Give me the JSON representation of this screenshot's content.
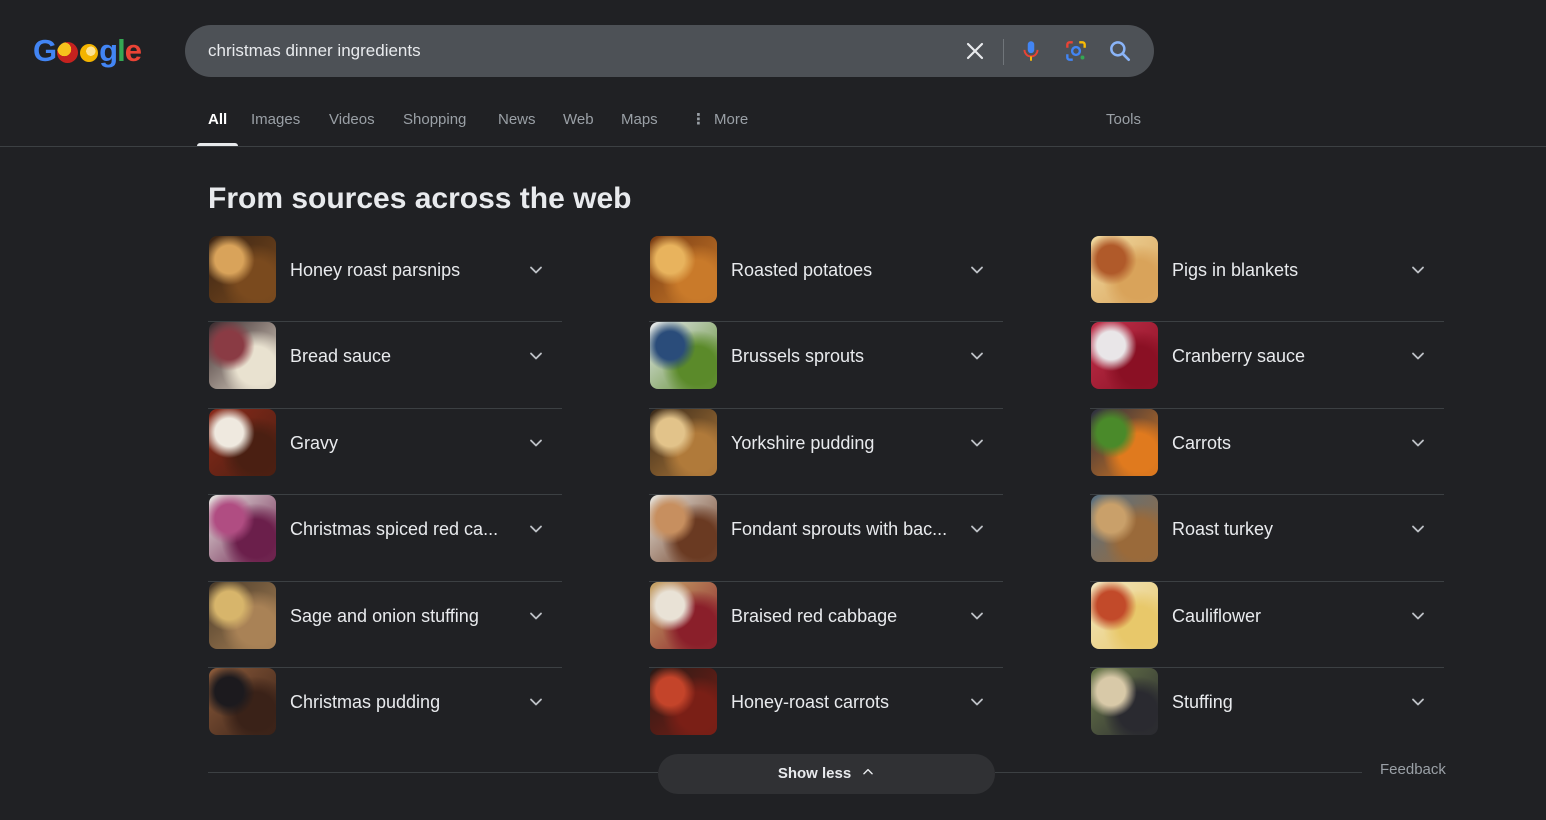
{
  "logo": {
    "label": "Google"
  },
  "search": {
    "value": "christmas dinner ingredients",
    "placeholder": "Search"
  },
  "tabs": [
    {
      "label": "All",
      "active": true
    },
    {
      "label": "Images"
    },
    {
      "label": "Videos"
    },
    {
      "label": "Shopping"
    },
    {
      "label": "News"
    },
    {
      "label": "Web"
    },
    {
      "label": "Maps"
    },
    {
      "label": "More"
    }
  ],
  "tools_label": "Tools",
  "heading": "From sources across the web",
  "columns": [
    [
      {
        "label": "Honey roast parsnips",
        "colors": [
          "#7a4a1e",
          "#d9a35a",
          "#3a2414"
        ]
      },
      {
        "label": "Bread sauce",
        "colors": [
          "#e9e2d0",
          "#8a3b44",
          "#3b2a2e"
        ]
      },
      {
        "label": "Gravy",
        "colors": [
          "#4a1f12",
          "#efe9df",
          "#8a2a1a"
        ]
      },
      {
        "label": "Christmas spiced red ca...",
        "colors": [
          "#6b1f4b",
          "#b04d82",
          "#e7e3e0"
        ]
      },
      {
        "label": "Sage and onion stuffing",
        "colors": [
          "#a98256",
          "#d7b56b",
          "#4a3b2a"
        ]
      },
      {
        "label": "Christmas pudding",
        "colors": [
          "#3a2218",
          "#1c1a1e",
          "#8a5a3a"
        ]
      }
    ],
    [
      {
        "label": "Roasted potatoes",
        "colors": [
          "#c97a2a",
          "#e8b35d",
          "#7a3d14"
        ]
      },
      {
        "label": "Brussels sprouts",
        "colors": [
          "#5b8a2a",
          "#2a4c7a",
          "#e6e9ef"
        ]
      },
      {
        "label": "Yorkshire pudding",
        "colors": [
          "#b07a3a",
          "#e2c38a",
          "#3a2a1a"
        ]
      },
      {
        "label": "Fondant sprouts with bac...",
        "colors": [
          "#6a3a22",
          "#c78f5f",
          "#e8e4dc"
        ]
      },
      {
        "label": "Braised red cabbage",
        "colors": [
          "#8a1f2a",
          "#e9e2d6",
          "#c8a86a"
        ]
      },
      {
        "label": "Honey-roast carrots",
        "colors": [
          "#7a1f16",
          "#c4442a",
          "#2a1a16"
        ]
      }
    ],
    [
      {
        "label": "Pigs in blankets",
        "colors": [
          "#d9a35a",
          "#b05a2a",
          "#f0d9a0"
        ]
      },
      {
        "label": "Cranberry sauce",
        "colors": [
          "#8a1024",
          "#e9e6e8",
          "#c0304a"
        ]
      },
      {
        "label": "Carrots",
        "colors": [
          "#e07a1e",
          "#4a8a2a",
          "#2a3040"
        ]
      },
      {
        "label": "Roast turkey",
        "colors": [
          "#9a6a3a",
          "#c9a06a",
          "#5a7080"
        ]
      },
      {
        "label": "Cauliflower",
        "colors": [
          "#e8c86a",
          "#c24a2a",
          "#f2e6c0"
        ]
      },
      {
        "label": "Stuffing",
        "colors": [
          "#2a2a30",
          "#d8c9a8",
          "#6b7a4a"
        ]
      }
    ]
  ],
  "show_less_label": "Show less",
  "feedback_label": "Feedback"
}
